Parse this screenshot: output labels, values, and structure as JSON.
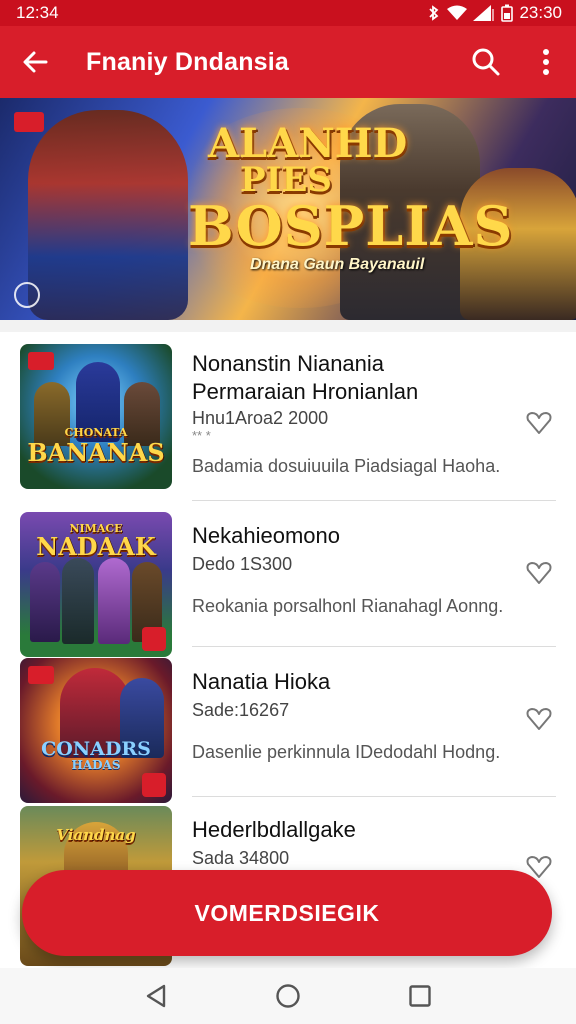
{
  "status_bar": {
    "time_left": "12:34",
    "time_right": "23:30",
    "icons": [
      "bluetooth-icon",
      "wifi-icon",
      "signal-icon",
      "battery-icon"
    ]
  },
  "app_bar": {
    "title": "Fnaniy Dndansia",
    "back_icon": "arrow-left-icon",
    "search_icon": "search-icon",
    "menu_icon": "more-vert-icon"
  },
  "banner": {
    "logo_line1": "ALANHD",
    "logo_line2": "PIES",
    "logo_line3": "BOSPLIAS",
    "tagline": "Dnana Gaun Bayanauil"
  },
  "items": [
    {
      "thumb_title": "BANANAS",
      "thumb_subtitle": "CHONATA",
      "name_line1": "Nonanstin Nianania",
      "name_line2": "Permaraian Hronianlan",
      "meta": "Hnu1Aroa2 2000",
      "rating": "** *",
      "desc": "Badamia dosuiuuila Piadsiagal Haoha."
    },
    {
      "thumb_title": "NADAAK",
      "thumb_subtitle": "NIMACE",
      "name_line1": "Nekahieomono",
      "meta": "Dedo 1S300",
      "desc": "Reokania porsalhonl Rianahagl Aonng."
    },
    {
      "thumb_title": "CONADRS",
      "thumb_subtitle": "HADAS",
      "name_line1": "Nanatia Hioka",
      "meta": "Sade:16267",
      "desc": "Dasenlie perkinnula IDedodahl Hodng."
    },
    {
      "thumb_title": "Viandnag",
      "name_line1": "Hederlbdlallgake",
      "meta": "Sada 34800"
    }
  ],
  "fab": {
    "label": "VOMERDSIEGIK"
  },
  "nav_bar": {
    "icons": [
      "back-triangle-icon",
      "home-circle-icon",
      "recents-square-icon"
    ]
  },
  "colors": {
    "primary": "#d81e2a",
    "status": "#c9101e"
  }
}
